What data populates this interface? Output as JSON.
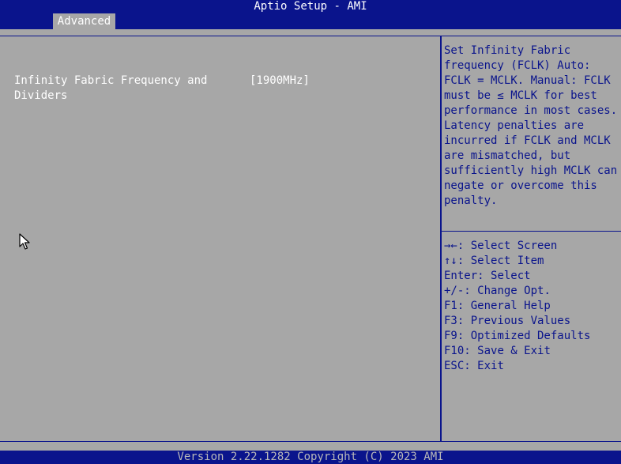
{
  "header": {
    "title": "Aptio Setup - AMI",
    "tabs": [
      {
        "label": "Advanced",
        "active": true
      }
    ]
  },
  "settings": [
    {
      "label": "Infinity Fabric Frequency and\nDividers",
      "value": "[1900MHz]"
    }
  ],
  "help": {
    "text": "Set Infinity Fabric frequency (FCLK) Auto: FCLK = MCLK. Manual: FCLK must be ≤ MCLK for best performance in most cases. Latency penalties are incurred if FCLK and MCLK are mismatched, but sufficiently high MCLK can negate or overcome this penalty."
  },
  "keys": [
    {
      "key": "→←",
      "action": ": Select Screen"
    },
    {
      "key": "↑↓",
      "action": ": Select Item"
    },
    {
      "key": "Enter",
      "action": ": Select"
    },
    {
      "key": "+/-",
      "action": ": Change Opt."
    },
    {
      "key": "F1",
      "action": ": General Help"
    },
    {
      "key": "F3",
      "action": ": Previous Values"
    },
    {
      "key": "F9",
      "action": ": Optimized Defaults"
    },
    {
      "key": "F10",
      "action": ": Save & Exit"
    },
    {
      "key": "ESC",
      "action": ": Exit"
    }
  ],
  "footer": {
    "text": "Version 2.22.1282 Copyright (C) 2023 AMI"
  },
  "colors": {
    "bar": "#0a148c",
    "background": "#a7a7a7",
    "text": "#ffffff",
    "help_text": "#0a148c"
  },
  "icons": {
    "cursor": "mouse-pointer-icon"
  }
}
